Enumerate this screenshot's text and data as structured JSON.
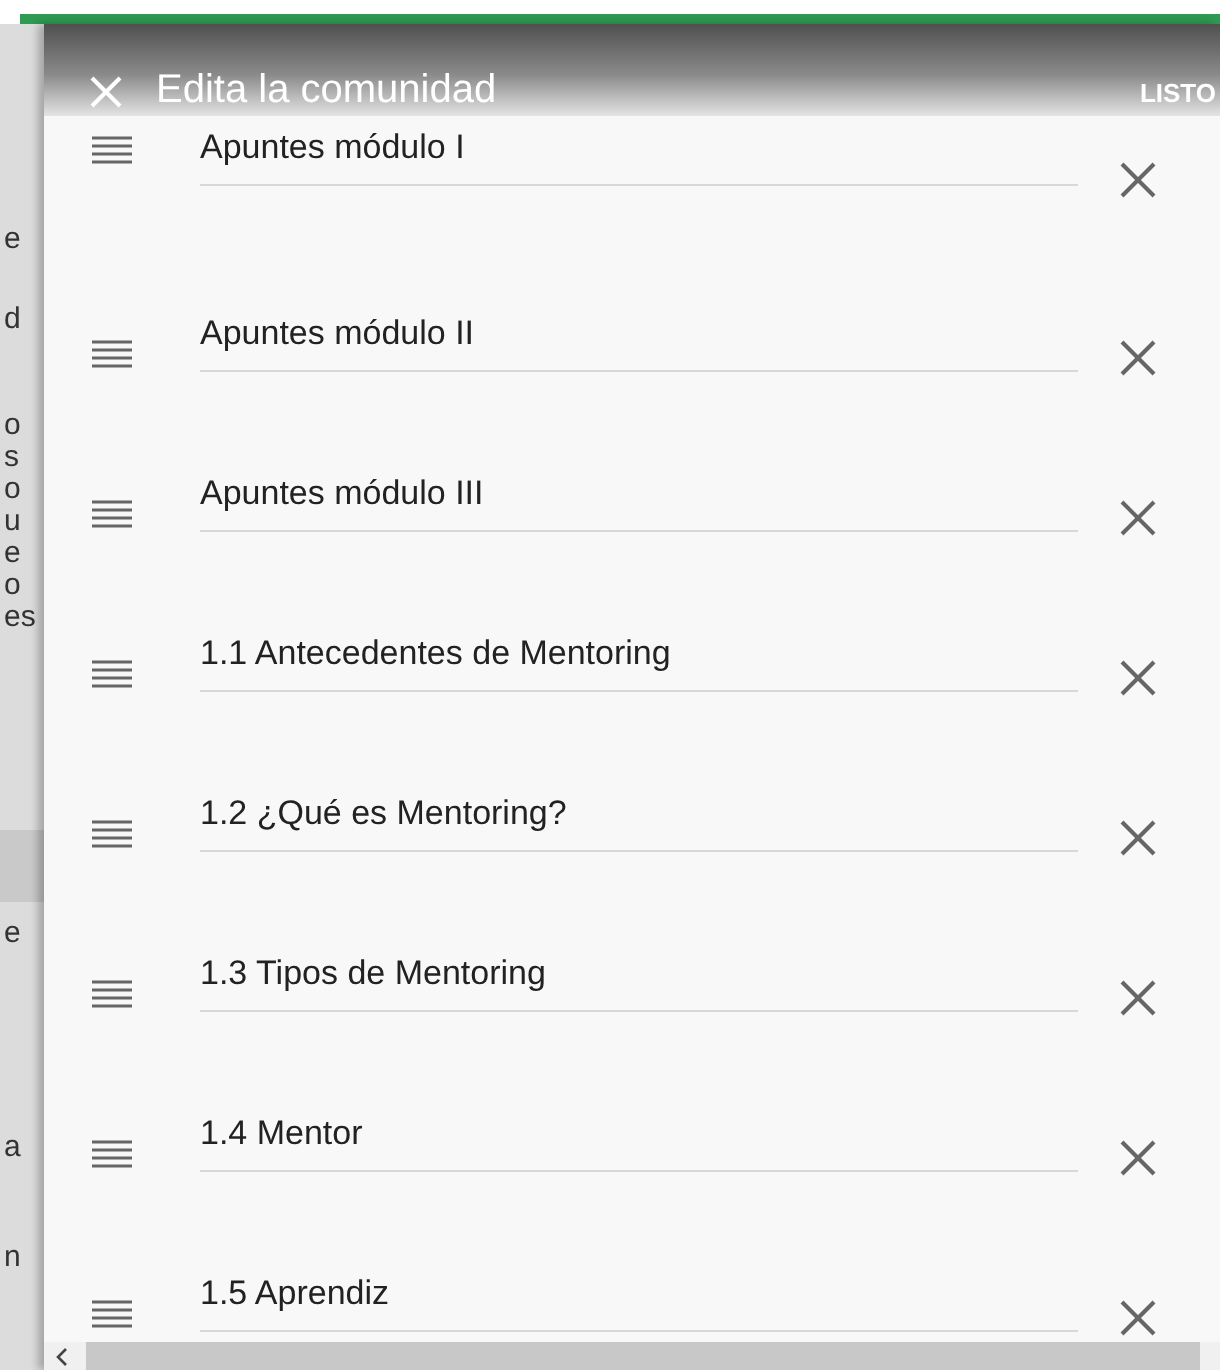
{
  "background_page": {
    "fragments": [
      "e",
      "d",
      "o",
      "s",
      "o",
      "u",
      "e",
      "o",
      "es",
      "e",
      "a",
      "n"
    ]
  },
  "dialog": {
    "title": "Edita la comunidad",
    "action": "LISTO",
    "items": [
      {
        "label": "Apuntes módulo I"
      },
      {
        "label": "Apuntes módulo II"
      },
      {
        "label": "Apuntes módulo III"
      },
      {
        "label": "1.1 Antecedentes de Mentoring"
      },
      {
        "label": "1.2 ¿Qué es Mentoring?"
      },
      {
        "label": "1.3 Tipos de Mentoring"
      },
      {
        "label": "1.4 Mentor"
      },
      {
        "label": "1.5 Aprendiz"
      }
    ]
  }
}
